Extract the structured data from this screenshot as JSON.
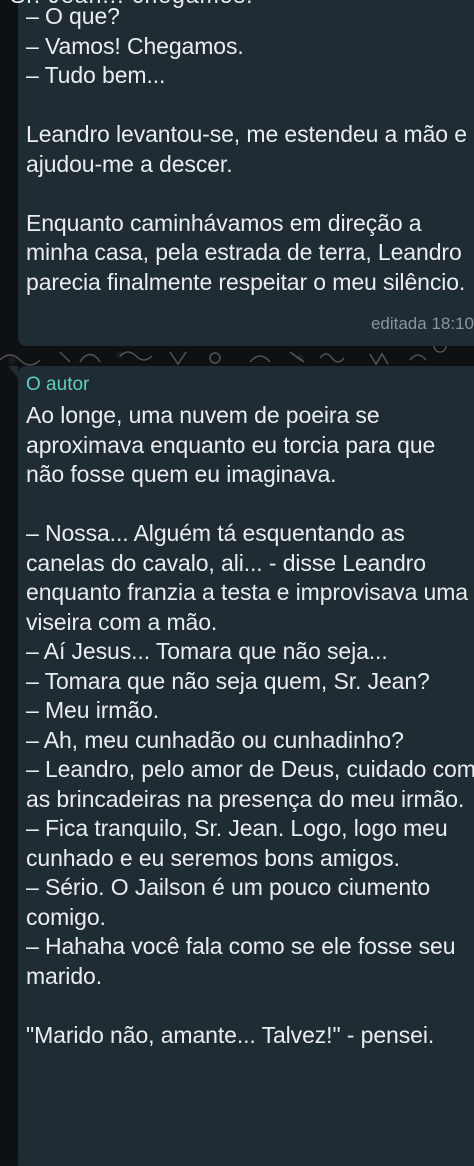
{
  "conversation": {
    "message_1": {
      "cut_off_line": "Sr. Jean... chegamos.",
      "text": "– O que?\n– Vamos! Chegamos.\n– Tudo bem...\n\nLeandro levantou-se, me estendeu a mão e ajudou-me a descer.\n\nEnquanto caminhávamos em direção a minha casa, pela estrada de terra, Leandro parecia finalmente respeitar o meu silêncio.",
      "edited_label": "editada",
      "time": "18:10"
    },
    "message_2": {
      "author": "O autor",
      "text": "Ao longe, uma nuvem de poeira se aproximava enquanto eu torcia para que não fosse quem eu imaginava.\n\n– Nossa... Alguém tá esquentando as canelas do cavalo, ali... - disse Leandro enquanto franzia a testa e improvisava uma viseira com a mão.\n– Aí Jesus... Tomara que não seja...\n– Tomara que não seja quem, Sr. Jean?\n– Meu irmão.\n– Ah, meu cunhadão ou cunhadinho?\n– Leandro, pelo amor de Deus, cuidado com as brincadeiras na presença do meu irmão.\n– Fica tranquilo, Sr. Jean. Logo, logo meu cunhado e eu seremos bons amigos.\n– Sério. O Jailson é um pouco ciumento comigo.\n– Hahaha você fala como se ele fosse seu marido.\n\n\"Marido não, amante... Talvez!\" - pensei."
    }
  },
  "colors": {
    "background": "#0d1113",
    "bubble": "#202c33",
    "text": "#e9edef",
    "meta": "#8696a0",
    "author": "#5fcfc0"
  }
}
